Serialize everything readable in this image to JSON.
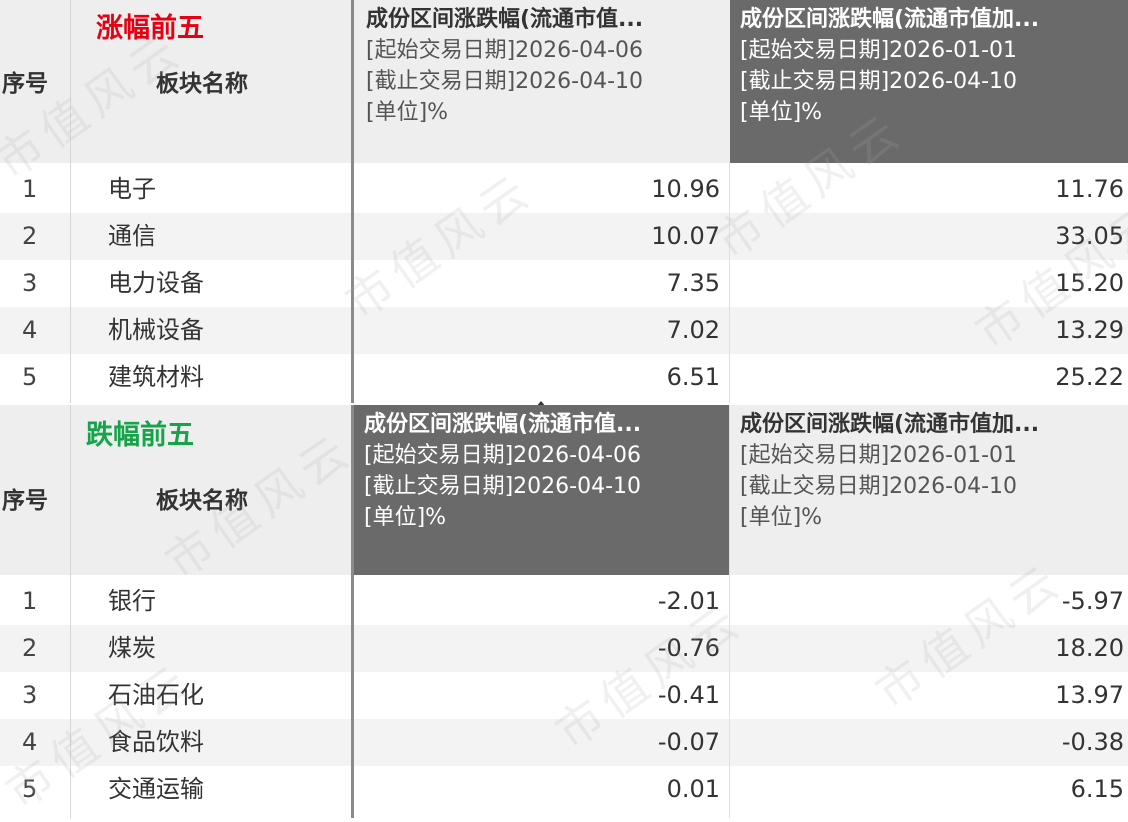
{
  "top": {
    "title": "涨幅前五",
    "header_seq": "序号",
    "header_name": "板块名称",
    "colA": {
      "title": "成份区间涨跌幅(流通市值...",
      "start": "[起始交易日期]2026-04-06",
      "end": "[截止交易日期]2026-04-10",
      "unit": "[单位]%"
    },
    "colB": {
      "title": "成份区间涨跌幅(流通市值加...",
      "start": "[起始交易日期]2026-01-01",
      "end": "[截止交易日期]2026-04-10",
      "unit": "[单位]%"
    },
    "rows": [
      {
        "seq": "1",
        "name": "电子",
        "a": "10.96",
        "b": "11.76"
      },
      {
        "seq": "2",
        "name": "通信",
        "a": "10.07",
        "b": "33.05"
      },
      {
        "seq": "3",
        "name": "电力设备",
        "a": "7.35",
        "b": "15.20"
      },
      {
        "seq": "4",
        "name": "机械设备",
        "a": "7.02",
        "b": "13.29"
      },
      {
        "seq": "5",
        "name": "建筑材料",
        "a": "6.51",
        "b": "25.22"
      }
    ]
  },
  "bottom": {
    "title": "跌幅前五",
    "header_seq": "序号",
    "header_name": "板块名称",
    "colA": {
      "title": "成份区间涨跌幅(流通市值...",
      "start": "[起始交易日期]2026-04-06",
      "end": "[截止交易日期]2026-04-10",
      "unit": "[单位]%"
    },
    "colB": {
      "title": "成份区间涨跌幅(流通市值加...",
      "start": "[起始交易日期]2026-01-01",
      "end": "[截止交易日期]2026-04-10",
      "unit": "[单位]%"
    },
    "rows": [
      {
        "seq": "1",
        "name": "银行",
        "a": "-2.01",
        "b": "-5.97"
      },
      {
        "seq": "2",
        "name": "煤炭",
        "a": "-0.76",
        "b": "18.20"
      },
      {
        "seq": "3",
        "name": "石油石化",
        "a": "-0.41",
        "b": "13.97"
      },
      {
        "seq": "4",
        "name": "食品饮料",
        "a": "-0.07",
        "b": "-0.38"
      },
      {
        "seq": "5",
        "name": "交通运输",
        "a": "0.01",
        "b": "6.15"
      }
    ]
  },
  "watermark": "市值风云",
  "colors": {
    "rise": "#e60012",
    "fall": "#16a34a",
    "dark_header": "#6a6a6a"
  }
}
